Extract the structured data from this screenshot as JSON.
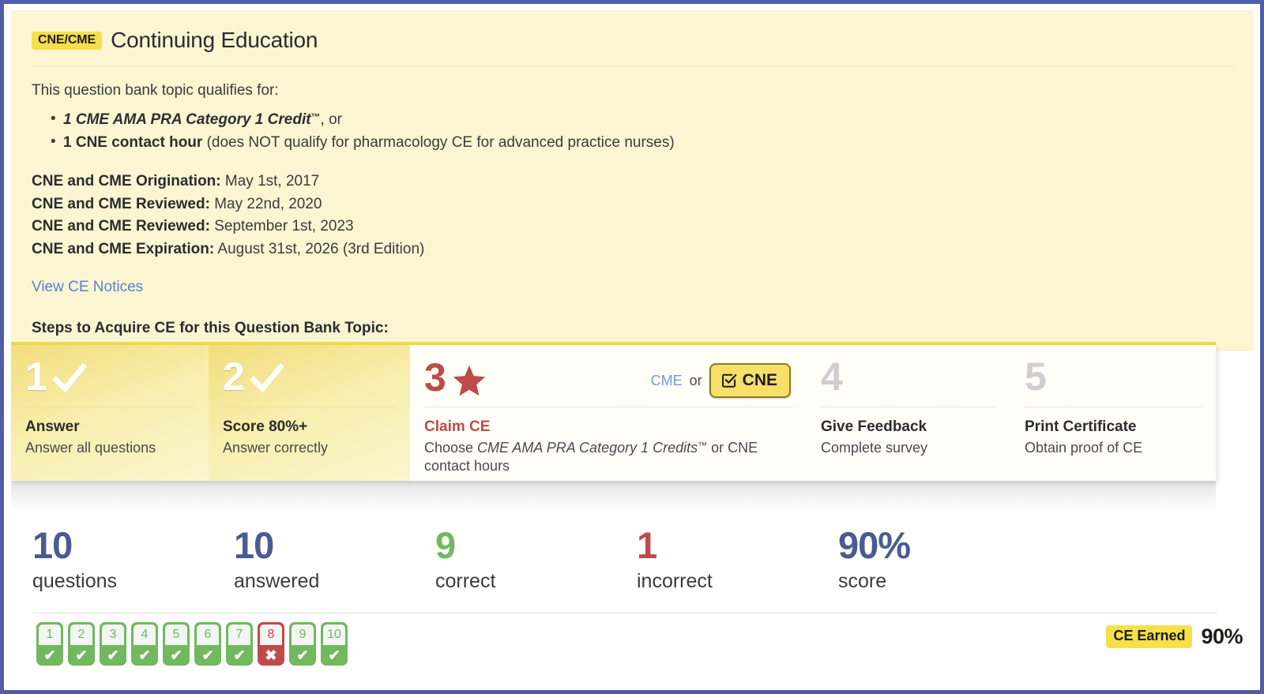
{
  "panel": {
    "badge": "CNE/CME",
    "title": "Continuing Education",
    "lead": "This question bank topic qualifies for:",
    "qualifies": [
      {
        "credit": "1 CME AMA PRA Category 1 Credit",
        "tm": "™",
        "suffix": ", or"
      },
      {
        "credit": "1 CNE contact hour",
        "tm": "",
        "suffix": " (does NOT qualify for pharmacology CE for advanced practice nurses)"
      }
    ],
    "dates": [
      {
        "label": "CNE and CME Origination:",
        "value": "May 1st, 2017"
      },
      {
        "label": "CNE and CME Reviewed:",
        "value": "May 22nd, 2020"
      },
      {
        "label": "CNE and CME Reviewed:",
        "value": "September 1st, 2023"
      },
      {
        "label": "CNE and CME Expiration:",
        "value": "August 31st, 2026 (3rd Edition)"
      }
    ],
    "notices_link": "View CE Notices",
    "steps_heading": "Steps to Acquire CE for this Question Bank Topic:"
  },
  "steps": [
    {
      "num": "1",
      "name": "Answer",
      "desc": "Answer all questions",
      "state": "done",
      "icon": "check-icon"
    },
    {
      "num": "2",
      "name": "Score 80%+",
      "desc": "Answer correctly",
      "state": "done",
      "icon": "check-icon"
    },
    {
      "num": "3",
      "name": "Claim CE",
      "desc_pre": "Choose ",
      "desc_em": "CME AMA PRA Category 1 Credits",
      "desc_tm": "™",
      "desc_post": " or CNE contact hours",
      "state": "active",
      "icon": "star-icon"
    },
    {
      "num": "4",
      "name": "Give Feedback",
      "desc": "Complete survey",
      "state": "pending",
      "icon": ""
    },
    {
      "num": "5",
      "name": "Print Certificate",
      "desc": "Obtain proof of CE",
      "state": "pending",
      "icon": ""
    }
  ],
  "claim_toggle": {
    "cme_label": "CME",
    "or_label": "or",
    "cne_label": "CNE",
    "cne_icon": "checkbox-checked-icon",
    "selected": "CNE"
  },
  "stats": [
    {
      "value": "10",
      "label": "questions",
      "color": "#4b5a92"
    },
    {
      "value": "10",
      "label": "answered",
      "color": "#4b5a92"
    },
    {
      "value": "9",
      "label": "correct",
      "color": "#71b85e"
    },
    {
      "value": "1",
      "label": "incorrect",
      "color": "#c04a4a"
    },
    {
      "value": "90%",
      "label": "score",
      "color": "#4b5a92"
    }
  ],
  "question_tiles": [
    {
      "num": "1",
      "result": "correct",
      "mark": "✔"
    },
    {
      "num": "2",
      "result": "correct",
      "mark": "✔"
    },
    {
      "num": "3",
      "result": "correct",
      "mark": "✔"
    },
    {
      "num": "4",
      "result": "correct",
      "mark": "✔"
    },
    {
      "num": "5",
      "result": "correct",
      "mark": "✔"
    },
    {
      "num": "6",
      "result": "correct",
      "mark": "✔"
    },
    {
      "num": "7",
      "result": "correct",
      "mark": "✔"
    },
    {
      "num": "8",
      "result": "incorrect",
      "mark": "✖"
    },
    {
      "num": "9",
      "result": "correct",
      "mark": "✔"
    },
    {
      "num": "10",
      "result": "correct",
      "mark": "✔"
    }
  ],
  "footer": {
    "ce_earned_badge": "CE Earned",
    "score_pct": "90%"
  },
  "colors": {
    "panel_bg": "#fbf5d2",
    "badge_yellow": "#f6df4a",
    "accent_blue": "#4b5a92",
    "link_blue": "#5b7fd4",
    "correct_green": "#71b85e",
    "incorrect_red": "#c04a4a",
    "frame_blue": "#4e5fa8"
  }
}
